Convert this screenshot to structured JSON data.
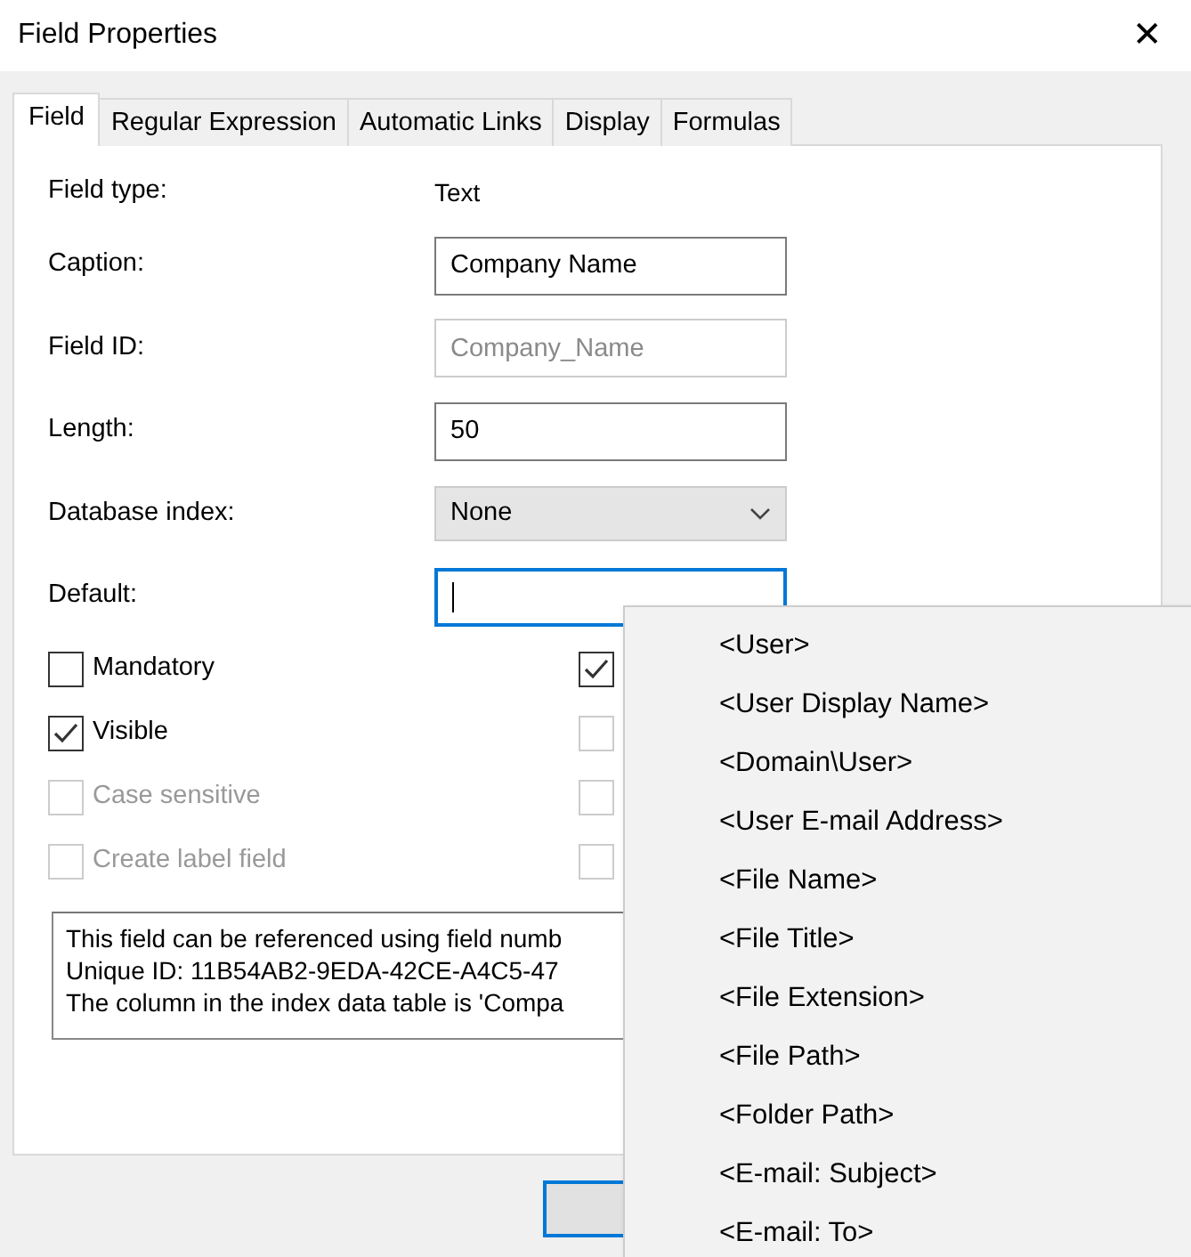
{
  "window": {
    "title": "Field Properties",
    "close": "✕"
  },
  "tabs": [
    {
      "label": "Field",
      "selected": true
    },
    {
      "label": "Regular Expression",
      "selected": false
    },
    {
      "label": "Automatic Links",
      "selected": false
    },
    {
      "label": "Display",
      "selected": false
    },
    {
      "label": "Formulas",
      "selected": false
    }
  ],
  "fields": [
    {
      "kind": "text",
      "label": "Field type:",
      "value": "Text"
    },
    {
      "kind": "input",
      "label": "Caption:",
      "value": "Company Name",
      "disabled": false,
      "focused": false
    },
    {
      "kind": "input",
      "label": "Field ID:",
      "value": "Company_Name",
      "disabled": true,
      "focused": false
    },
    {
      "kind": "input",
      "label": "Length:",
      "value": "50",
      "disabled": false,
      "focused": false
    },
    {
      "kind": "select",
      "label": "Database index:",
      "value": "None"
    },
    {
      "kind": "input",
      "label": "Default:",
      "disabled": false,
      "focused": true
    }
  ],
  "checkboxes": [
    {
      "label": "Mandatory",
      "checked": false,
      "disabled": false
    },
    {
      "checked": true,
      "disabled": false
    },
    {
      "label": "Visible",
      "checked": true,
      "disabled": false
    },
    {
      "checked": false,
      "disabled": true
    },
    {
      "label": "Case sensitive",
      "checked": false,
      "disabled": true
    },
    {
      "checked": false,
      "disabled": true
    },
    {
      "label": "Create label field",
      "checked": false,
      "disabled": true
    },
    {
      "checked": false,
      "disabled": true
    }
  ],
  "info": [
    "This field can be referenced using field numb",
    "Unique ID: 11B54AB2-9EDA-42CE-A4C5-47",
    "The column in the index data table is 'Compa"
  ],
  "menu": {
    "items": [
      "<User>",
      "<User Display Name>",
      "<Domain\\User>",
      "<User E-mail Address>",
      "<File Name>",
      "<File Title>",
      "<File Extension>",
      "<File Path>",
      "<Folder Path>",
      "<E-mail: Subject>",
      "<E-mail: To>"
    ]
  }
}
